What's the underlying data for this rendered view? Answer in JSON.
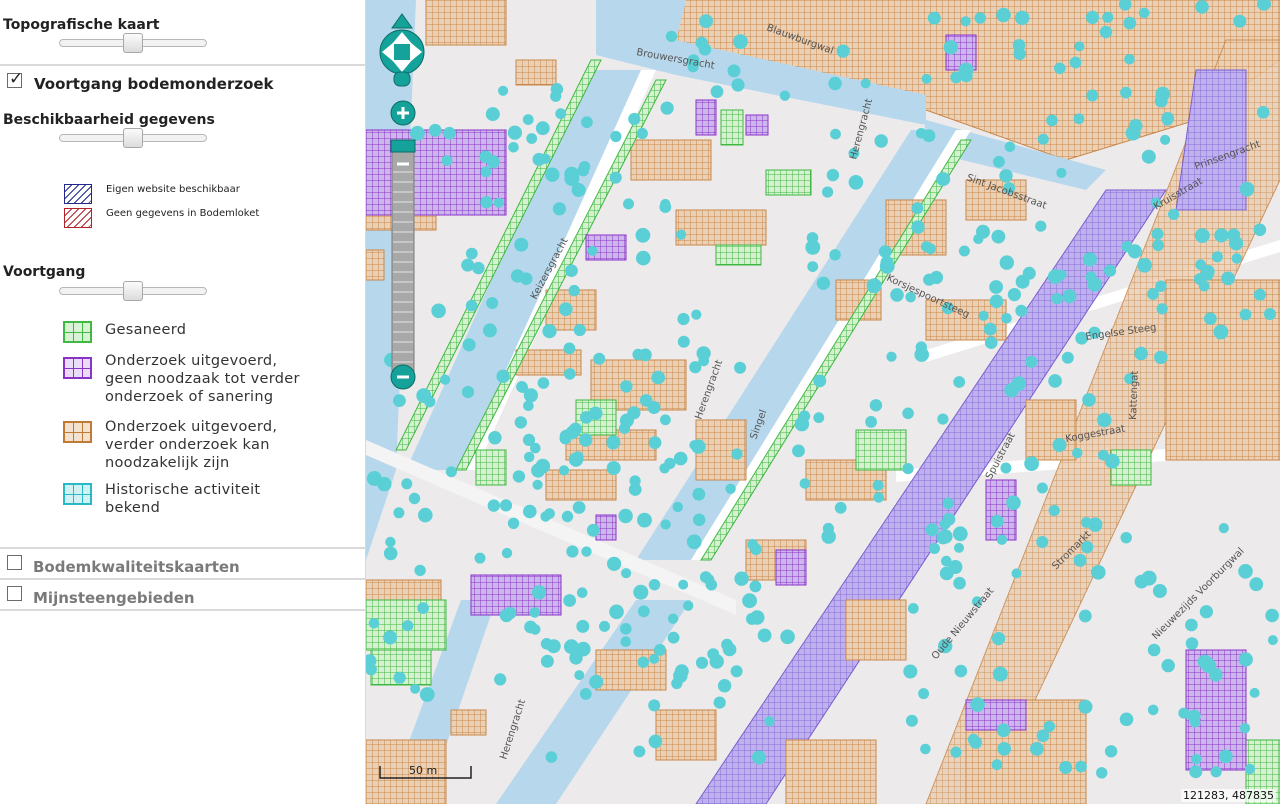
{
  "sidebar": {
    "topo": {
      "title": "Topografische kaart",
      "opacity": 0.5
    },
    "voortgang_layer": {
      "label": "Voortgang bodemonderzoek",
      "checked": true
    },
    "beschikbaarheid": {
      "title": "Beschikbaarheid gegevens",
      "opacity": 0.5,
      "legend": [
        {
          "label": "Eigen website beschikbaar",
          "color": "#1f2a8c"
        },
        {
          "label": "Geen gegevens in Bodemloket",
          "color": "#b2232a"
        }
      ]
    },
    "voortgang": {
      "title": "Voortgang",
      "opacity": 0.5,
      "legend": [
        {
          "lines": [
            "Gesaneerd"
          ],
          "color": "#3fb944"
        },
        {
          "lines": [
            "Onderzoek uitgevoerd,",
            "geen noodzaak tot verder",
            "onderzoek of sanering"
          ],
          "color": "#8a34c8"
        },
        {
          "lines": [
            "Onderzoek uitgevoerd,",
            "verder onderzoek kan",
            "noodzakelijk zijn"
          ],
          "color": "#c07a35"
        },
        {
          "lines": [
            "Historische activiteit",
            "bekend"
          ],
          "color": "#29b8c6"
        }
      ]
    },
    "other_layers": [
      {
        "label": "Bodemkwaliteitskaarten",
        "checked": false
      },
      {
        "label": "Mijnsteengebieden",
        "checked": false
      }
    ]
  },
  "map": {
    "scale_label": "50 m",
    "coordinates": "121283, 487835",
    "zoom_level_fraction": 0.78,
    "street_names": [
      "Brouwersgracht",
      "Keizersgracht",
      "Herengracht",
      "Herengracht",
      "Herengracht",
      "Singel",
      "Koggestraat",
      "Kattengat",
      "Spuistraat",
      "Oude Nieuwstraat",
      "Nieuwezijds Voorburgwal",
      "Stromarkt",
      "Korsjespoortsteeg",
      "Sint Jacobsstraat",
      "Engelse Steeg",
      "Kruisstraat",
      "Prinsengracht",
      "Blauwburgwal"
    ],
    "colors": {
      "water": "#b7d8ec",
      "land": "#eceaea",
      "road": "#ffffff",
      "orange": "#c9874a",
      "orange_fill": "#ead0b4",
      "green": "#3fb944",
      "purple": "#8a34c8",
      "purple_fill": "#cdb6ec",
      "cyan": "#5bcfd6"
    }
  }
}
